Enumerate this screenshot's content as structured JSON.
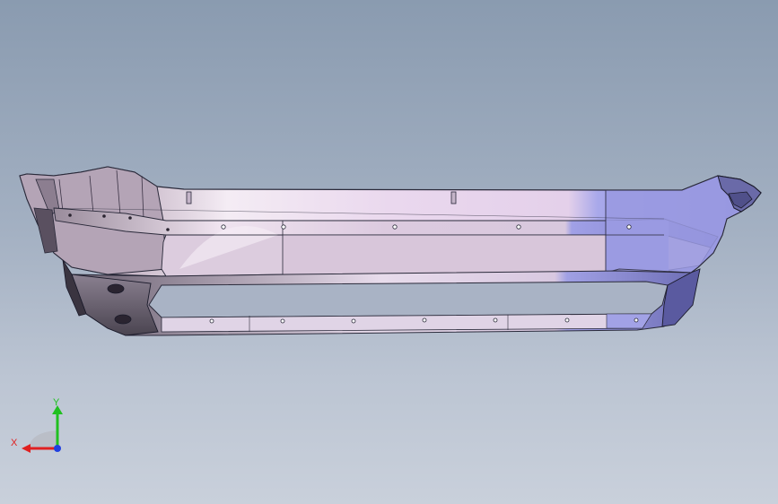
{
  "model": {
    "shading": {
      "left": "#b8a8b8",
      "center": "#e8d8ec",
      "right": "#9a9ae0",
      "edge": "#1a1a2a"
    }
  },
  "triad": {
    "x_label": "X",
    "y_label": "Y",
    "x_color": "#e02020",
    "y_color": "#20c020",
    "z_color": "#2040e0"
  }
}
